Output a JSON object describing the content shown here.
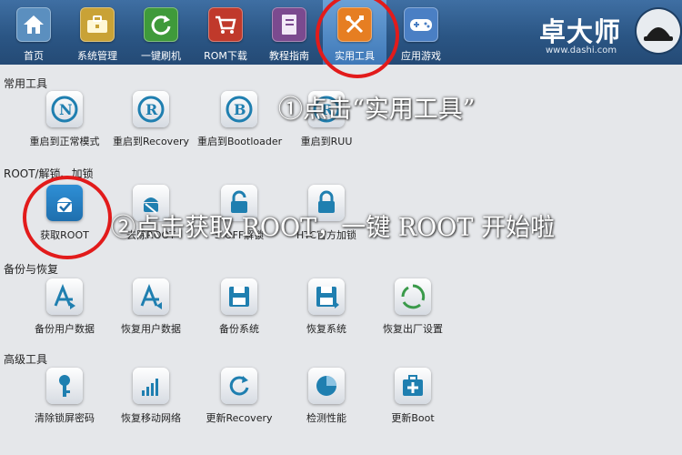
{
  "nav": [
    {
      "label": "首页",
      "icon": "home-icon",
      "color": "#5b8fbf"
    },
    {
      "label": "系统管理",
      "icon": "toolbox-icon",
      "color": "#c9a236"
    },
    {
      "label": "一键刷机",
      "icon": "refresh-icon",
      "color": "#3f9a3a"
    },
    {
      "label": "ROM下载",
      "icon": "cart-icon",
      "color": "#c0392b"
    },
    {
      "label": "教程指南",
      "icon": "book-icon",
      "color": "#7b4a8f"
    },
    {
      "label": "实用工具",
      "icon": "tools-icon",
      "color": "#e67e22"
    },
    {
      "label": "应用游戏",
      "icon": "gamepad-icon",
      "color": "#4a7fc4"
    }
  ],
  "brand": {
    "name": "卓大师",
    "url": "www.dashi.com"
  },
  "sections": {
    "common": "常用工具",
    "root": "ROOT/解锁、加锁",
    "backup": "备份与恢复",
    "advanced": "高级工具"
  },
  "tools": {
    "common": [
      "重启到正常模式",
      "重启到Recovery",
      "重启到Bootloader",
      "重启到RUU"
    ],
    "root": [
      "获取ROOT",
      "去除ROOT",
      "S-OFF解锁",
      "HTC官方加锁"
    ],
    "backup": [
      "备份用户数据",
      "恢复用户数据",
      "备份系统",
      "恢复系统",
      "恢复出厂设置"
    ],
    "advanced": [
      "清除锁屏密码",
      "恢复移动网络",
      "更新Recovery",
      "检测性能",
      "更新Boot"
    ]
  },
  "annotations": {
    "step1": "①点击“实用工具”",
    "step2": "②点击获取 ROOT，一键 ROOT 开始啦"
  },
  "colors": {
    "accent": "#1f7fb0",
    "highlight": "#e21b1b"
  }
}
